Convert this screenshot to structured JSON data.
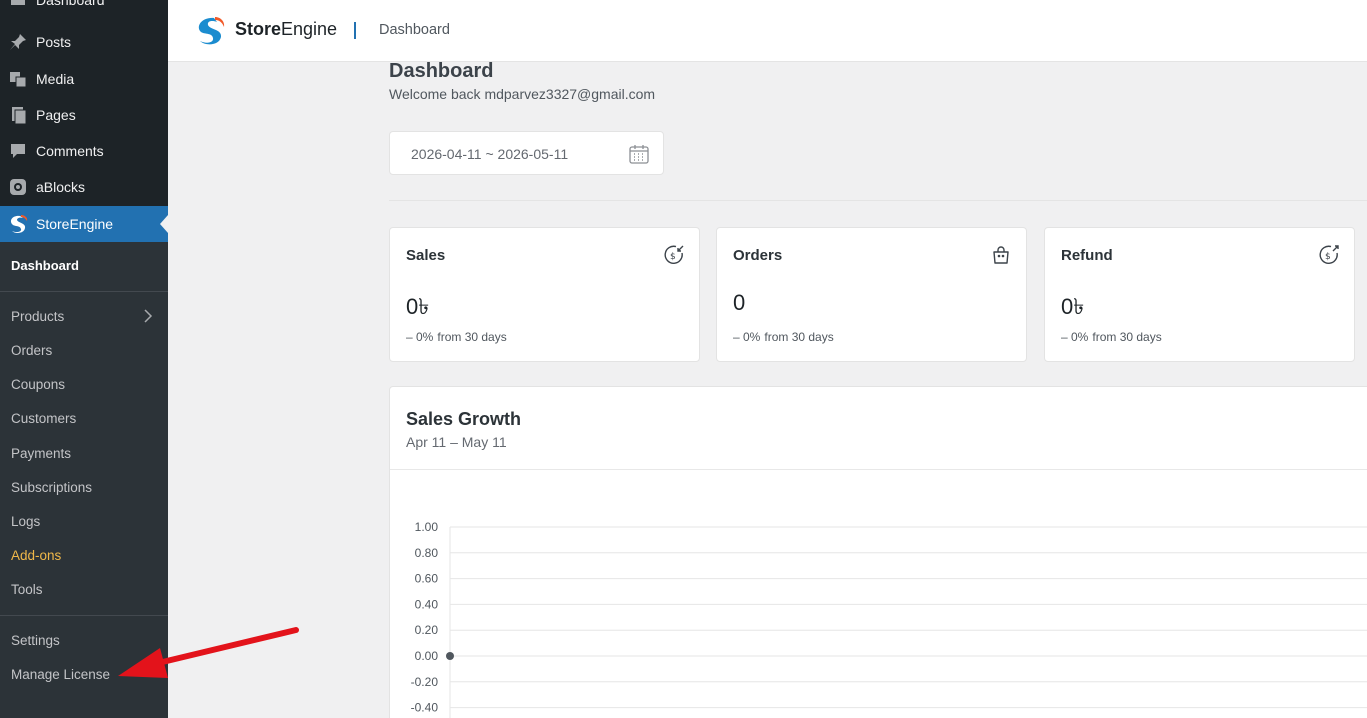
{
  "wp_menu": {
    "items": [
      {
        "label": "Dashboard",
        "icon": "dashboard-icon"
      },
      {
        "label": "Posts",
        "icon": "pin-icon"
      },
      {
        "label": "Media",
        "icon": "media-icon"
      },
      {
        "label": "Pages",
        "icon": "pages-icon"
      },
      {
        "label": "Comments",
        "icon": "comments-icon"
      },
      {
        "label": "aBlocks",
        "icon": "ablocks-icon"
      },
      {
        "label": "StoreEngine",
        "icon": "storeengine-icon"
      }
    ],
    "submenu": [
      "Dashboard",
      "Products",
      "Orders",
      "Coupons",
      "Customers",
      "Payments",
      "Subscriptions",
      "Logs",
      "Add-ons",
      "Tools",
      "Settings",
      "Manage License"
    ]
  },
  "header": {
    "brand_bold": "Store",
    "brand_rest": "Engine",
    "breadcrumb": "Dashboard"
  },
  "main": {
    "title": "Dashboard",
    "welcome": "Welcome back mdparvez3327@gmail.com",
    "date_range": "2026-04-11 ~ 2026-05-11"
  },
  "cards": [
    {
      "title": "Sales",
      "value": "0৳",
      "pct": "– 0%",
      "from": "from 30 days",
      "icon": "sales-icon"
    },
    {
      "title": "Orders",
      "value": "0",
      "pct": "– 0%",
      "from": "from 30 days",
      "icon": "bag-icon"
    },
    {
      "title": "Refund",
      "value": "0৳",
      "pct": "– 0%",
      "from": "from 30 days",
      "icon": "refund-icon"
    }
  ],
  "growth": {
    "title": "Sales Growth",
    "subtitle": "Apr 11 – May 11"
  },
  "chart_data": {
    "type": "line",
    "title": "Sales Growth",
    "yticks": [
      "1.00",
      "0.80",
      "0.60",
      "0.40",
      "0.20",
      "0.00",
      "-0.20",
      "-0.40"
    ],
    "ylim": [
      -0.4,
      1.0
    ],
    "series": [
      {
        "values": [
          0
        ]
      }
    ],
    "grid": true
  },
  "colors": {
    "accent": "#2271b1",
    "sidebar": "#1d2327",
    "submenu": "#2c3338",
    "addons": "#f0b849",
    "arrow": "#e3131b"
  }
}
